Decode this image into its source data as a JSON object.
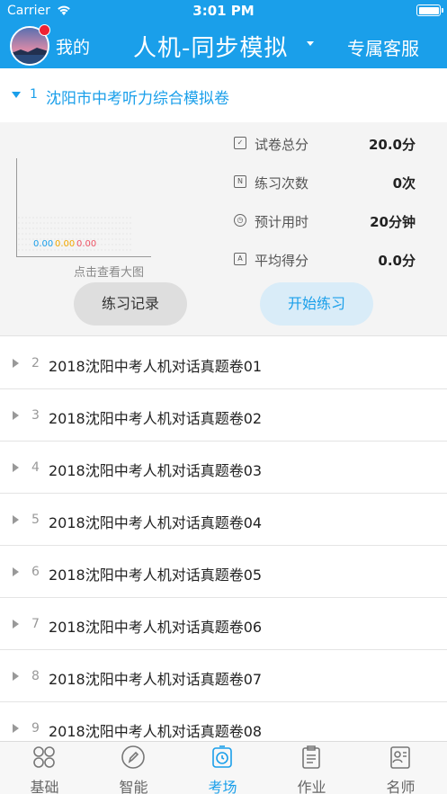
{
  "status_bar": {
    "carrier": "Carrier",
    "time": "3:01 PM"
  },
  "header": {
    "my_label": "我的",
    "title": "人机-同步模拟",
    "service_label": "专属客服"
  },
  "expanded": {
    "index": "1",
    "name": "沈阳市中考听力综合模拟卷",
    "chart_values": [
      "0.00",
      "0.00",
      "0.00"
    ],
    "chart_caption": "点击查看大图",
    "stats": [
      {
        "label": "试卷总分",
        "value": "20.0分",
        "icon": "clipboard-check-icon"
      },
      {
        "label": "练习次数",
        "value": "0次",
        "icon": "n-box-icon"
      },
      {
        "label": "预计用时",
        "value": "20分钟",
        "icon": "clock-icon"
      },
      {
        "label": "平均得分",
        "value": "0.0分",
        "icon": "a-box-icon"
      }
    ],
    "record_button": "练习记录",
    "start_button": "开始练习"
  },
  "list": [
    {
      "index": "2",
      "name": "2018沈阳中考人机对话真题卷01"
    },
    {
      "index": "3",
      "name": "2018沈阳中考人机对话真题卷02"
    },
    {
      "index": "4",
      "name": "2018沈阳中考人机对话真题卷03"
    },
    {
      "index": "5",
      "name": "2018沈阳中考人机对话真题卷04"
    },
    {
      "index": "6",
      "name": "2018沈阳中考人机对话真题卷05"
    },
    {
      "index": "7",
      "name": "2018沈阳中考人机对话真题卷06"
    },
    {
      "index": "8",
      "name": "2018沈阳中考人机对话真题卷07"
    },
    {
      "index": "9",
      "name": "2018沈阳中考人机对话真题卷08"
    }
  ],
  "tabs": [
    {
      "label": "基础",
      "icon": "grid-circles-icon",
      "active": false
    },
    {
      "label": "智能",
      "icon": "pen-circle-icon",
      "active": false
    },
    {
      "label": "考场",
      "icon": "timer-icon",
      "active": true
    },
    {
      "label": "作业",
      "icon": "clipboard-list-icon",
      "active": false
    },
    {
      "label": "名师",
      "icon": "teacher-card-icon",
      "active": false
    }
  ],
  "colors": {
    "brand": "#1a9fea",
    "value_blue": "#1a9fea",
    "value_orange": "#f2a800",
    "value_red": "#ee5566"
  }
}
